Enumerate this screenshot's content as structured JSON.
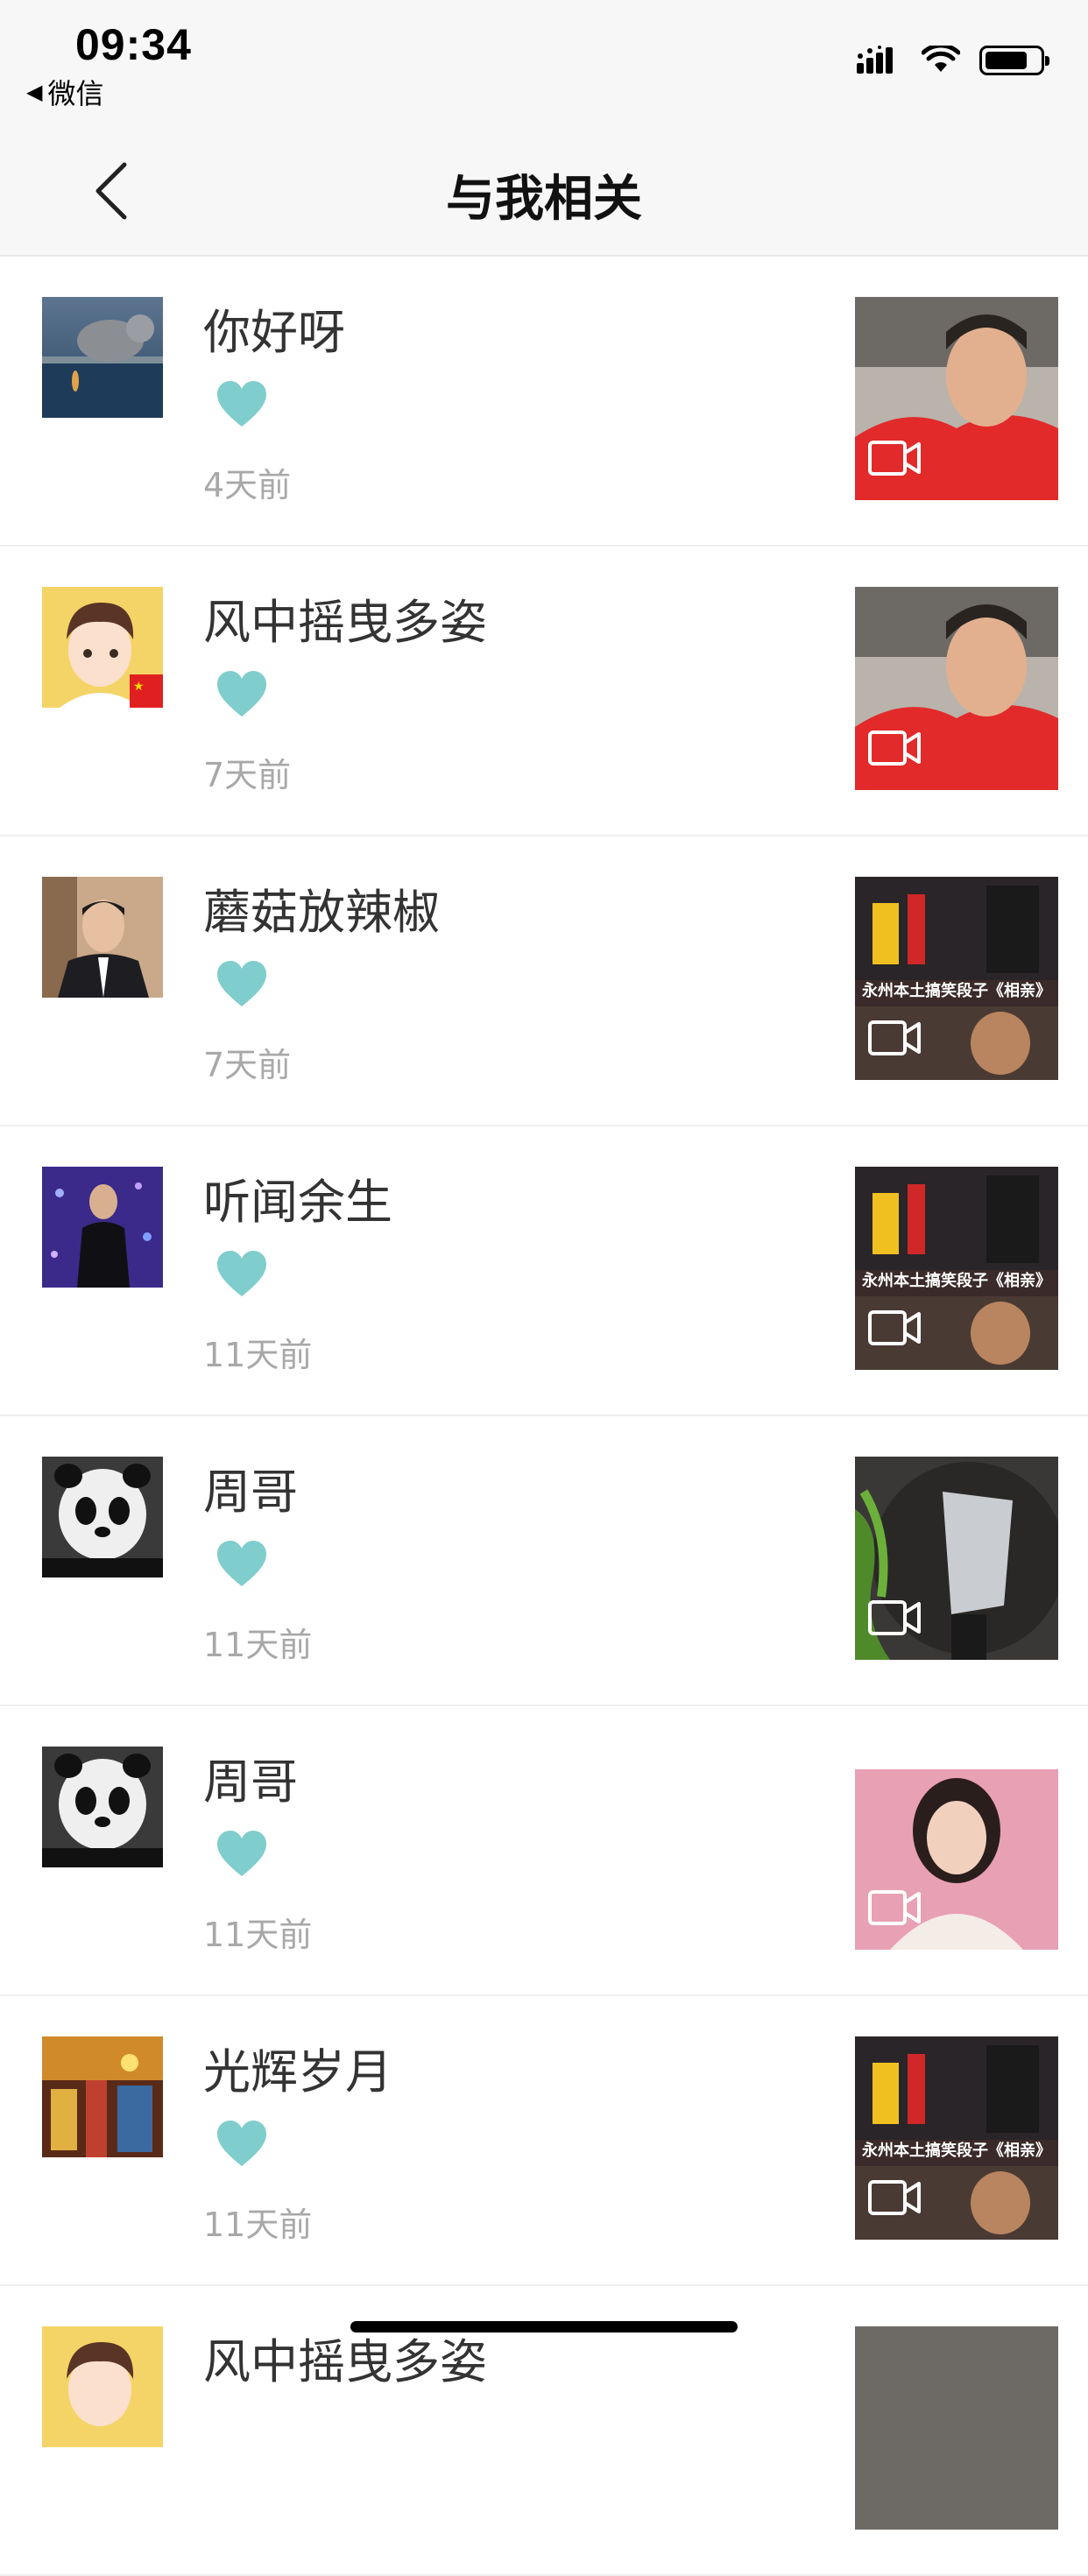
{
  "status_bar": {
    "time": "09:34",
    "back_app_label": "微信",
    "signal_icon": "signal-icon",
    "wifi_icon": "wifi-icon",
    "battery_icon": "battery-icon"
  },
  "nav": {
    "title": "与我相关",
    "back_icon": "chevron-left-icon"
  },
  "colors": {
    "heart": "#7fcdcc",
    "time_ago": "#a8a8a8",
    "header_bg": "#f7f7f7"
  },
  "items": [
    {
      "name": "你好呀",
      "time_ago": "4天前",
      "thumb_caption": ""
    },
    {
      "name": "风中摇曳多姿",
      "time_ago": "7天前",
      "thumb_caption": ""
    },
    {
      "name": "蘑菇放辣椒",
      "time_ago": "7天前",
      "thumb_caption": "永州本土搞笑段子《相亲》"
    },
    {
      "name": "听闻余生",
      "time_ago": "11天前",
      "thumb_caption": "永州本土搞笑段子《相亲》"
    },
    {
      "name": "周哥",
      "time_ago": "11天前",
      "thumb_caption": ""
    },
    {
      "name": "周哥",
      "time_ago": "11天前",
      "thumb_caption": ""
    },
    {
      "name": "光辉岁月",
      "time_ago": "11天前",
      "thumb_caption": "永州本土搞笑段子《相亲》"
    },
    {
      "name": "风中摇曳多姿",
      "time_ago": "",
      "thumb_caption": ""
    }
  ]
}
